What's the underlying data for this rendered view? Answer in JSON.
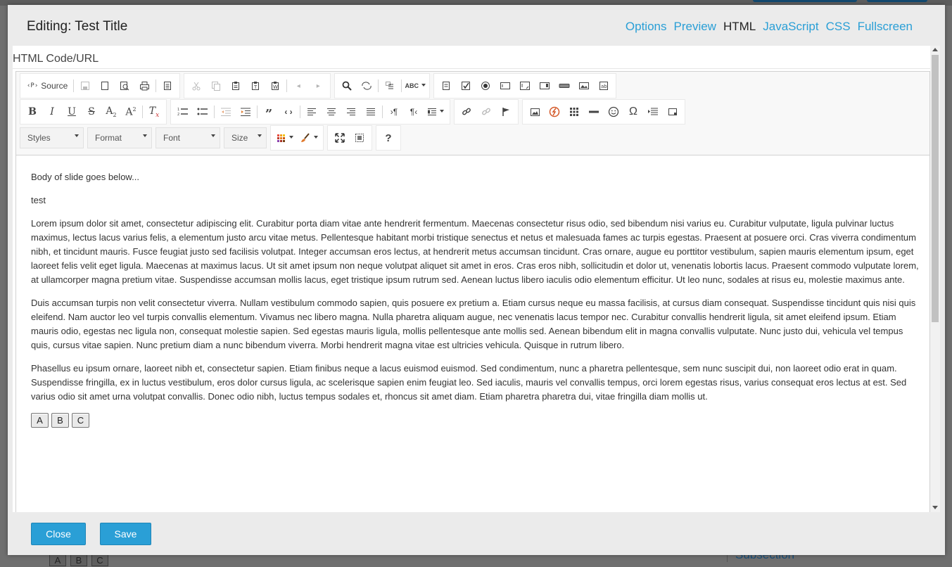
{
  "modal": {
    "title": "Editing: Test Title",
    "tabs": [
      {
        "label": "Options",
        "active": false
      },
      {
        "label": "Preview",
        "active": false
      },
      {
        "label": "HTML",
        "active": true
      },
      {
        "label": "JavaScript",
        "active": false
      },
      {
        "label": "CSS",
        "active": false
      },
      {
        "label": "Fullscreen",
        "active": false
      }
    ],
    "field_label": "HTML Code/URL"
  },
  "toolbar": {
    "source_label": "Source",
    "styles_label": "Styles",
    "format_label": "Format",
    "font_label": "Font",
    "size_label": "Size",
    "help_label": "?",
    "omega": "Ω"
  },
  "document": {
    "heading": "Body of slide goes below...",
    "line2": "test",
    "para1": "Lorem ipsum dolor sit amet, consectetur adipiscing elit. Curabitur porta diam vitae ante hendrerit fermentum. Maecenas consectetur risus odio, sed bibendum nisi varius eu. Curabitur vulputate, ligula pulvinar luctus maximus, lectus lacus varius felis, a elementum justo arcu vitae metus. Pellentesque habitant morbi tristique senectus et netus et malesuada fames ac turpis egestas. Praesent at posuere orci. Cras viverra condimentum nibh, et tincidunt mauris. Fusce feugiat justo sed facilisis volutpat. Integer accumsan eros lectus, at hendrerit metus accumsan tincidunt. Cras ornare, augue eu porttitor vestibulum, sapien mauris elementum ipsum, eget laoreet felis velit eget ligula. Maecenas at maximus lacus. Ut sit amet ipsum non neque volutpat aliquet sit amet in eros. Cras eros nibh, sollicitudin et dolor ut, venenatis lobortis lacus. Praesent commodo vulputate lorem, at ullamcorper magna pretium vitae. Suspendisse accumsan mollis lacus, eget tristique ipsum rutrum sed. Aenean luctus libero iaculis odio elementum efficitur. Ut leo nunc, sodales at risus eu, molestie maximus ante.",
    "para2": "Duis accumsan turpis non velit consectetur viverra. Nullam vestibulum commodo sapien, quis posuere ex pretium a. Etiam cursus neque eu massa facilisis, at cursus diam consequat. Suspendisse tincidunt quis nisi quis eleifend. Nam auctor leo vel turpis convallis elementum. Vivamus nec libero magna. Nulla pharetra aliquam augue, nec venenatis lacus tempor nec. Curabitur convallis hendrerit ligula, sit amet eleifend ipsum. Etiam mauris odio, egestas nec ligula non, consequat molestie sapien. Sed egestas mauris ligula, mollis pellentesque ante mollis sed. Aenean bibendum elit in magna convallis vulputate. Nunc justo dui, vehicula vel tempus quis, cursus vitae sapien. Nunc pretium diam a nunc bibendum viverra. Morbi hendrerit magna vitae est ultricies vehicula. Quisque in rutrum libero.",
    "para3": "Phasellus eu ipsum ornare, laoreet nibh et, consectetur sapien. Etiam finibus neque a lacus euismod euismod. Sed condimentum, nunc a pharetra pellentesque, sem nunc suscipit dui, non laoreet odio erat in quam. Suspendisse fringilla, ex in luctus vestibulum, eros dolor cursus ligula, ac scelerisque sapien enim feugiat leo. Sed iaculis, mauris vel convallis tempus, orci lorem egestas risus, varius consequat eros lectus at est. Sed varius odio sit amet urna volutpat convallis. Donec odio nibh, luctus tempus sodales et, rhoncus sit amet diam. Etiam pharetra pharetra dui, vitae fringilla diam mollis ut.",
    "buttons": [
      "A",
      "B",
      "C"
    ]
  },
  "footer": {
    "close_label": "Close",
    "save_label": "Save"
  },
  "background": {
    "subsection_label": "Subsection",
    "abc": [
      "A",
      "B",
      "C"
    ]
  },
  "colors": {
    "accent": "#2a9fd6",
    "modal_bg": "#ebebeb",
    "overlay": "#6f6f6f"
  }
}
